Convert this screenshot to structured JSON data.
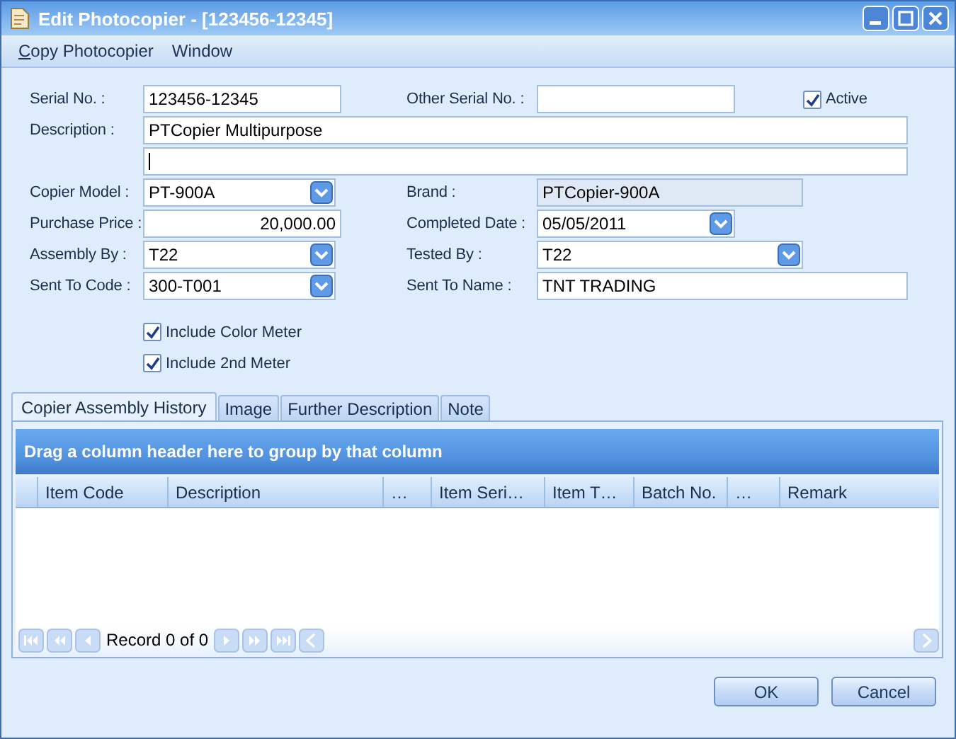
{
  "window": {
    "title": "Edit Photocopier - [123456-12345]"
  },
  "menu": [
    {
      "label": "Copy Photocopier",
      "mnemonic_underlined": true
    },
    {
      "label": "Window",
      "mnemonic_underlined": false
    }
  ],
  "form_rows": [
    [
      {
        "kind": "text",
        "label": "Serial No. :",
        "value": "123456-12345"
      },
      {
        "kind": "text",
        "label": "Other Serial No. :"
      },
      {
        "kind": "checkbox",
        "label": "Active",
        "checked": true
      }
    ],
    [
      {
        "kind": "wide",
        "label": "Description :",
        "value": "PTCopier Multipurpose"
      }
    ],
    [
      {
        "kind": "wide",
        "focused": true
      }
    ],
    [
      {
        "kind": "combo",
        "label": "Copier Model :",
        "value": "PT-900A"
      },
      {
        "kind": "readonly",
        "label": "Brand :",
        "value": "PTCopier-900A"
      }
    ],
    [
      {
        "kind": "number",
        "label": "Purchase Price :",
        "value": "20,000.00"
      },
      {
        "kind": "combo",
        "label": "Completed Date :",
        "value": "05/05/2011"
      }
    ],
    [
      {
        "kind": "combo",
        "label": "Assembly By :",
        "value": "T22"
      },
      {
        "kind": "combo",
        "label": "Tested By :",
        "value": "T22"
      }
    ],
    [
      {
        "kind": "combo",
        "label": "Sent To Code :",
        "value": "300-T001"
      },
      {
        "kind": "text",
        "label": "Sent To Name :",
        "value": "TNT TRADING"
      }
    ]
  ],
  "options": [
    {
      "label": "Include Color Meter",
      "checked": true
    },
    {
      "label": "Include 2nd Meter",
      "checked": true
    }
  ],
  "tabs": [
    {
      "label": "Copier Assembly History",
      "selected": true
    },
    {
      "label": "Image",
      "selected": false
    },
    {
      "label": "Further Description",
      "selected": false
    },
    {
      "label": "Note",
      "selected": false
    }
  ],
  "grid": {
    "group_panel": "Drag a column header here to group by that column",
    "columns": [
      "Item Code",
      "Description",
      "…",
      "Item Seri…",
      "Item T…",
      "Batch No.",
      "…",
      "Remark"
    ],
    "navigator": "Record 0 of 0"
  },
  "buttons": [
    "OK",
    "Cancel"
  ]
}
